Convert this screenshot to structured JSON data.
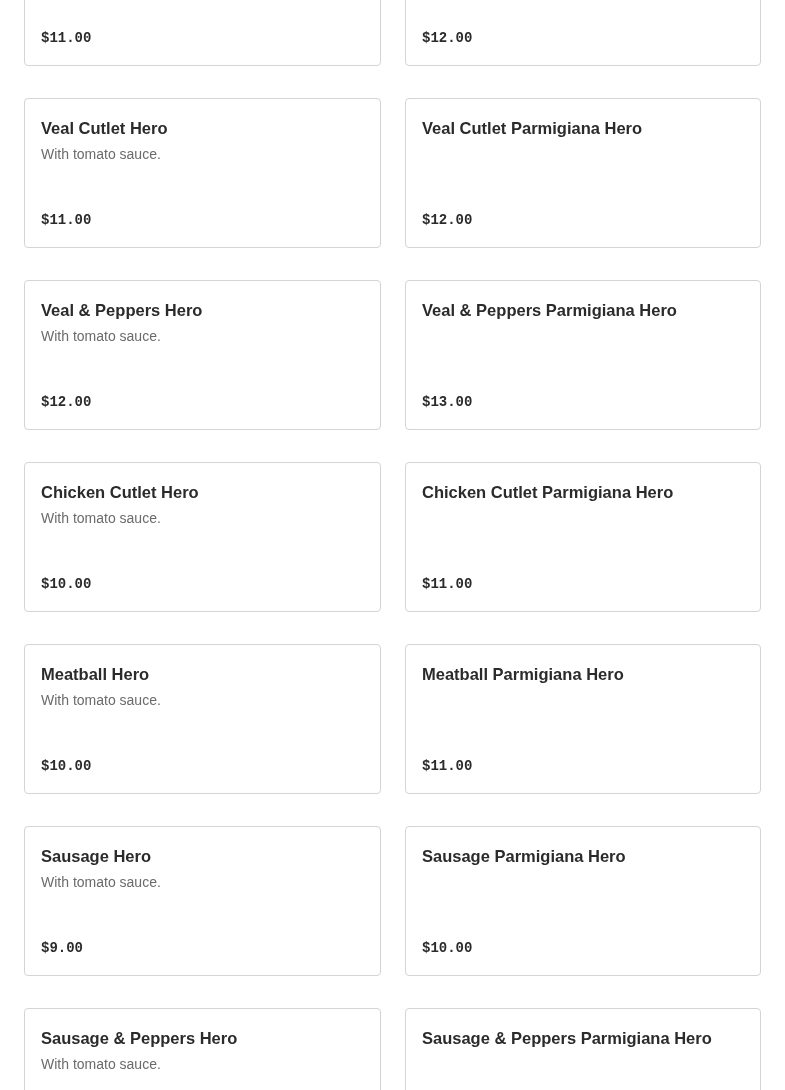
{
  "items": [
    {
      "price": "$11.00"
    },
    {
      "price": "$12.00"
    },
    {
      "name": "Veal Cutlet Hero",
      "description": "With tomato sauce.",
      "price": "$11.00"
    },
    {
      "name": "Veal Cutlet Parmigiana Hero",
      "price": "$12.00"
    },
    {
      "name": "Veal & Peppers Hero",
      "description": "With tomato sauce.",
      "price": "$12.00"
    },
    {
      "name": "Veal & Peppers Parmigiana Hero",
      "price": "$13.00"
    },
    {
      "name": "Chicken Cutlet Hero",
      "description": "With tomato sauce.",
      "price": "$10.00"
    },
    {
      "name": "Chicken Cutlet Parmigiana Hero",
      "price": "$11.00"
    },
    {
      "name": "Meatball Hero",
      "description": "With tomato sauce.",
      "price": "$10.00"
    },
    {
      "name": "Meatball Parmigiana Hero",
      "price": "$11.00"
    },
    {
      "name": "Sausage Hero",
      "description": "With tomato sauce.",
      "price": "$9.00"
    },
    {
      "name": "Sausage Parmigiana Hero",
      "price": "$10.00"
    },
    {
      "name": "Sausage & Peppers Hero",
      "description": "With tomato sauce."
    },
    {
      "name": "Sausage & Peppers Parmigiana Hero"
    }
  ]
}
